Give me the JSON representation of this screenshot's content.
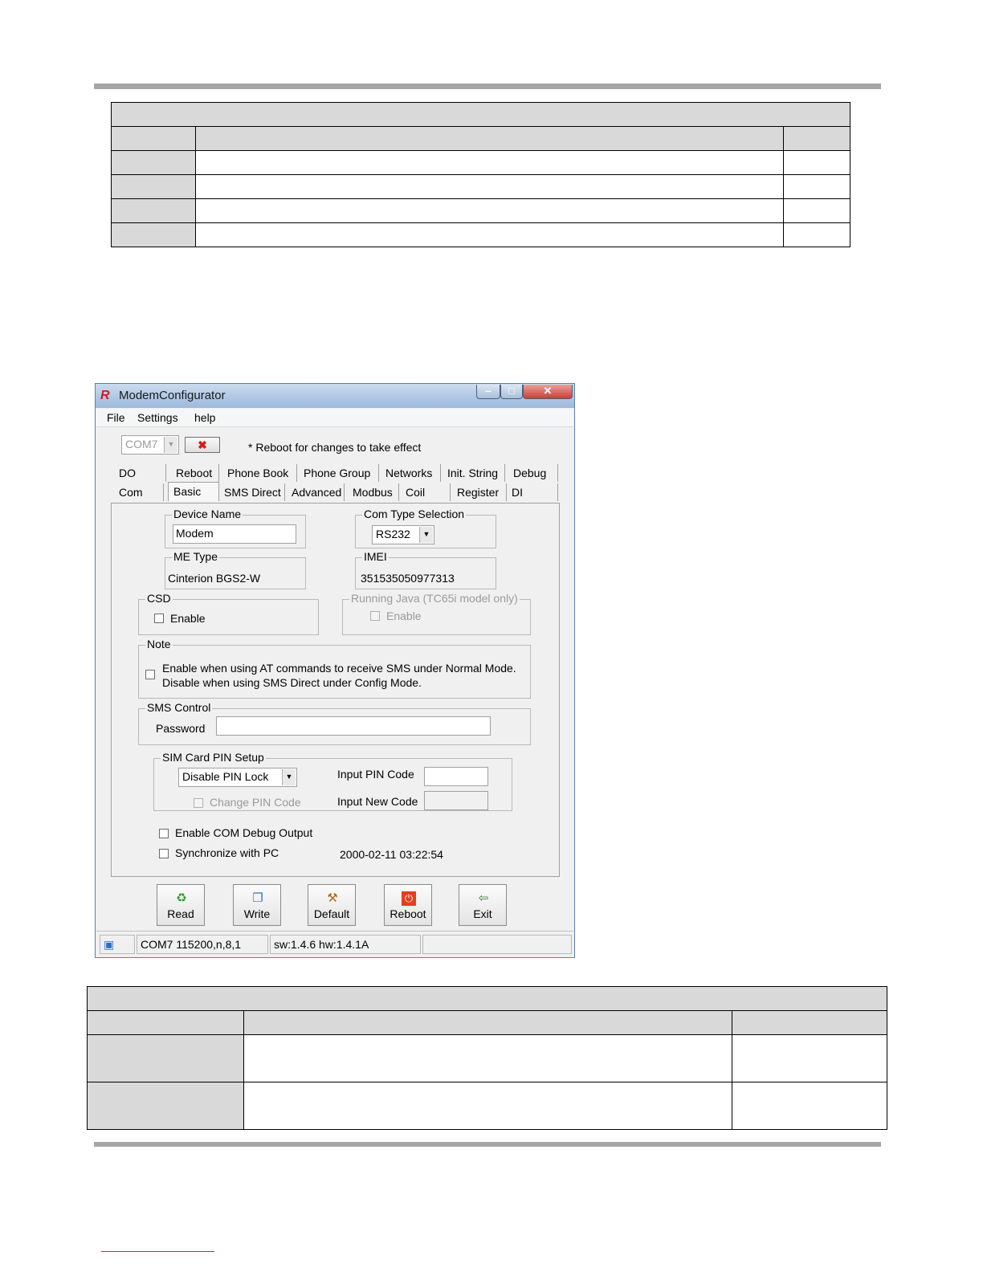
{
  "window": {
    "title": "ModemConfigurator",
    "menu": [
      "File",
      "Settings",
      "help"
    ],
    "port_select": {
      "value": "COM7"
    },
    "reboot_note": "* Reboot for changes to take effect",
    "tabs_row1": [
      "DO",
      "Reboot",
      "Phone Book",
      "Phone Group",
      "Networks",
      "Init. String",
      "Debug"
    ],
    "tabs_row2": [
      "Com",
      "Basic",
      "SMS Direct",
      "Advanced",
      "Modbus",
      "Coil",
      "Register",
      "DI"
    ],
    "active_tab": "Basic",
    "device_name": {
      "label": "Device Name",
      "value": "Modem"
    },
    "com_type": {
      "label": "Com Type Selection",
      "value": "RS232"
    },
    "me_type": {
      "label": "ME Type",
      "value": "Cinterion BGS2-W"
    },
    "imei": {
      "label": "IMEI",
      "value": "351535050977313"
    },
    "csd": {
      "label": "CSD",
      "checkbox": "Enable"
    },
    "java": {
      "label": "Running Java (TC65i model only)",
      "checkbox": "Enable"
    },
    "note": {
      "label": "Note",
      "line1": "Enable when using AT commands to receive SMS under Normal Mode.",
      "line2": "Disable when using SMS Direct under Config Mode."
    },
    "sms_control": {
      "label": "SMS Control",
      "password_label": "Password",
      "password_value": ""
    },
    "sim_pin": {
      "label": "SIM Card PIN Setup",
      "mode": "Disable PIN Lock",
      "change_pin": "Change PIN Code",
      "input_pin_label": "Input PIN Code",
      "input_new_label": "Input New Code"
    },
    "debug_output": "Enable COM Debug Output",
    "sync_pc": "Synchronize with PC",
    "datetime": "2000-02-11 03:22:54",
    "buttons": {
      "read": "Read",
      "write": "Write",
      "default": "Default",
      "reboot": "Reboot",
      "exit": "Exit"
    },
    "status": {
      "port": "COM7 115200,n,8,1",
      "version": "sw:1.4.6 hw:1.4.1A"
    },
    "colors": {
      "accent_red": "#d21c1c",
      "close_button": "#c9403a",
      "titlebar": "#aec6e3"
    }
  }
}
